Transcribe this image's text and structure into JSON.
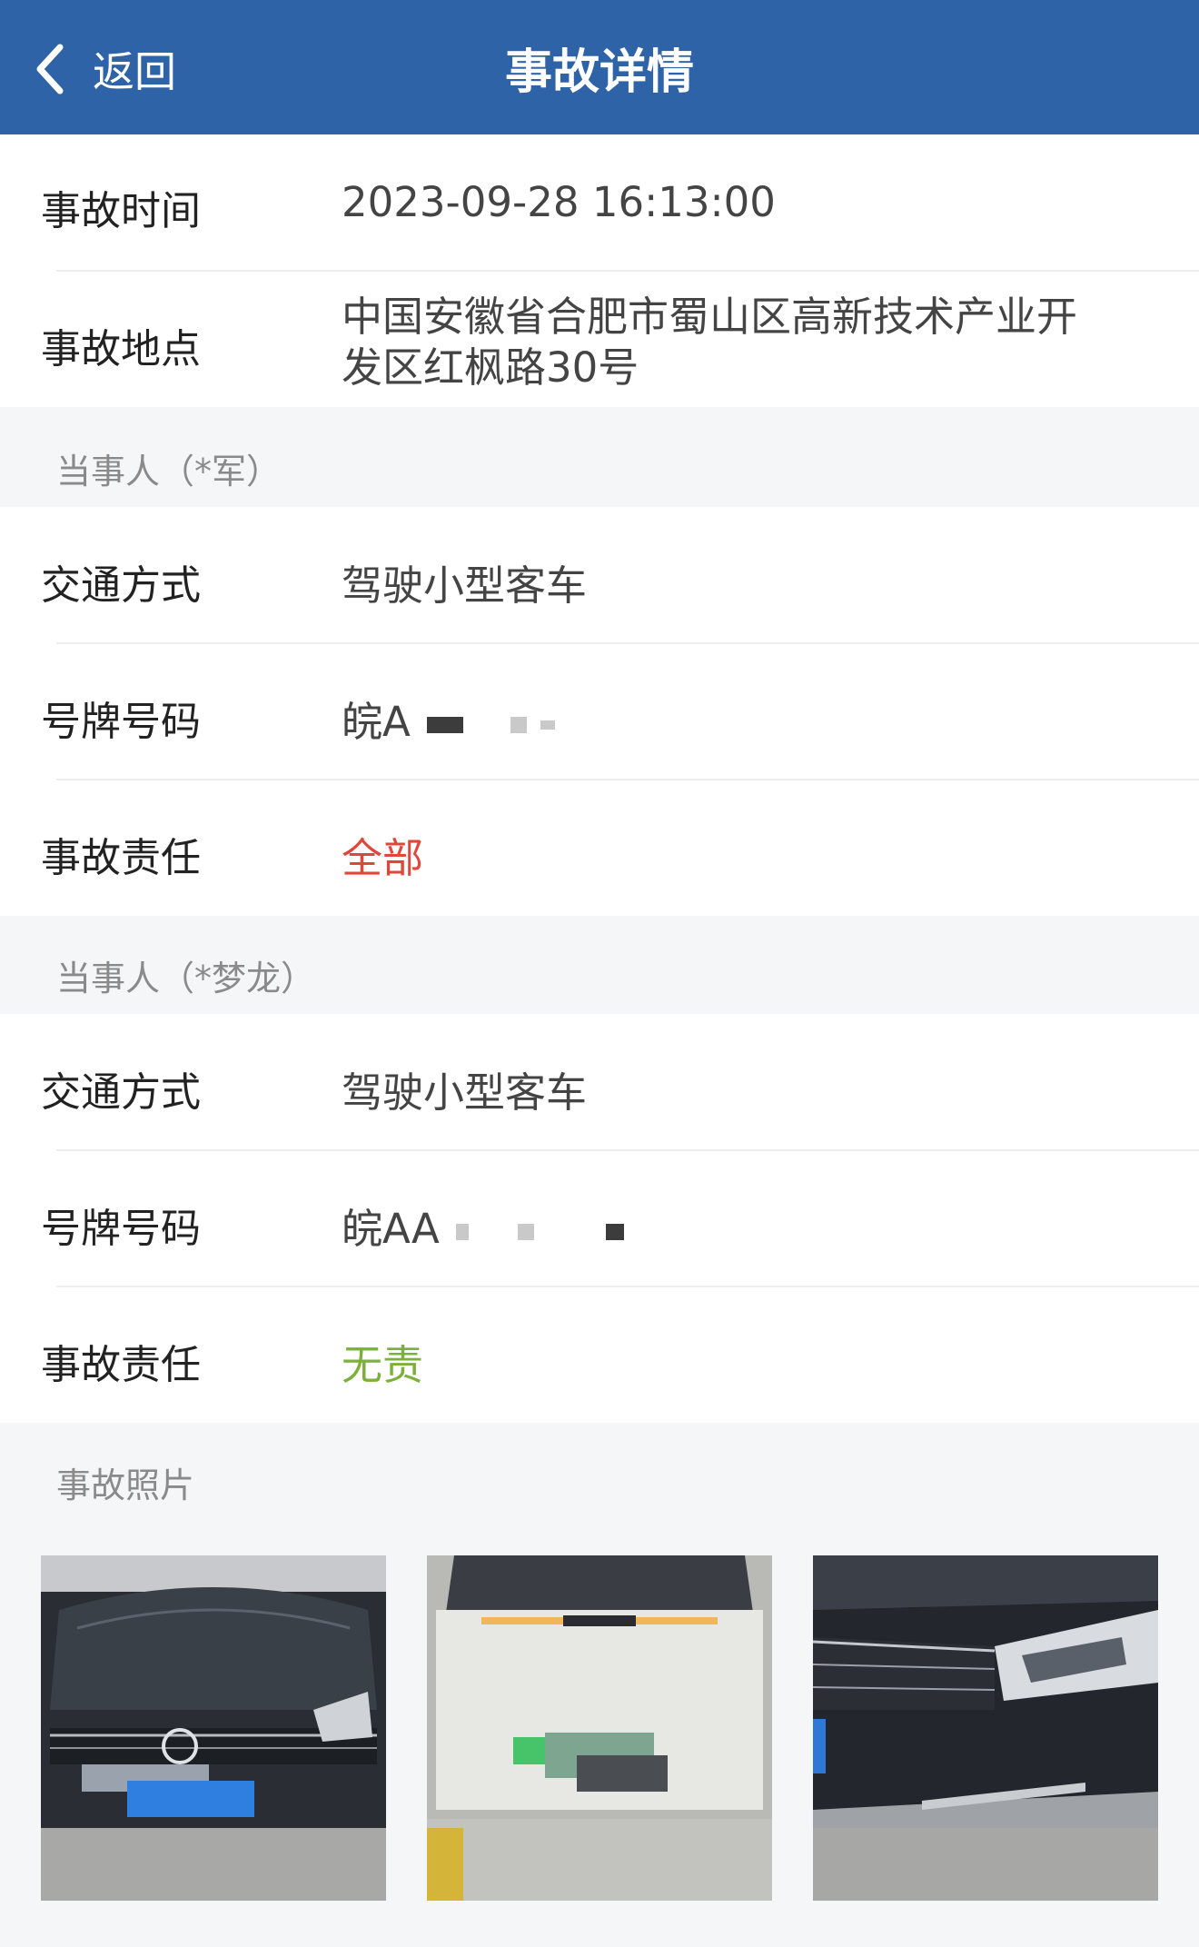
{
  "header": {
    "back_label": "返回",
    "title": "事故详情"
  },
  "accident": {
    "time_label": "事故时间",
    "time_value": "2023-09-28 16:13:00",
    "location_label": "事故地点",
    "location_line1": "中国安徽省合肥市蜀山区高新技术产业开",
    "location_line2": "发区红枫路30号"
  },
  "party1": {
    "section_title": "当事人（*军）",
    "transport_label": "交通方式",
    "transport_value": "驾驶小型客车",
    "plate_label": "号牌号码",
    "plate_value": "皖A",
    "responsibility_label": "事故责任",
    "responsibility_value": "全部",
    "responsibility_color": "#e0473c"
  },
  "party2": {
    "section_title": "当事人（*梦龙）",
    "transport_label": "交通方式",
    "transport_value": "驾驶小型客车",
    "plate_label": "号牌号码",
    "plate_value": "皖AA",
    "responsibility_label": "事故责任",
    "responsibility_value": "无责",
    "responsibility_color": "#7bb03a"
  },
  "photos": {
    "section_title": "事故照片",
    "items": [
      {
        "name": "accident-photo-1"
      },
      {
        "name": "accident-photo-2"
      },
      {
        "name": "accident-photo-3"
      }
    ]
  },
  "colors": {
    "header_bg": "#2f63a8",
    "page_bg": "#f5f6f8"
  }
}
